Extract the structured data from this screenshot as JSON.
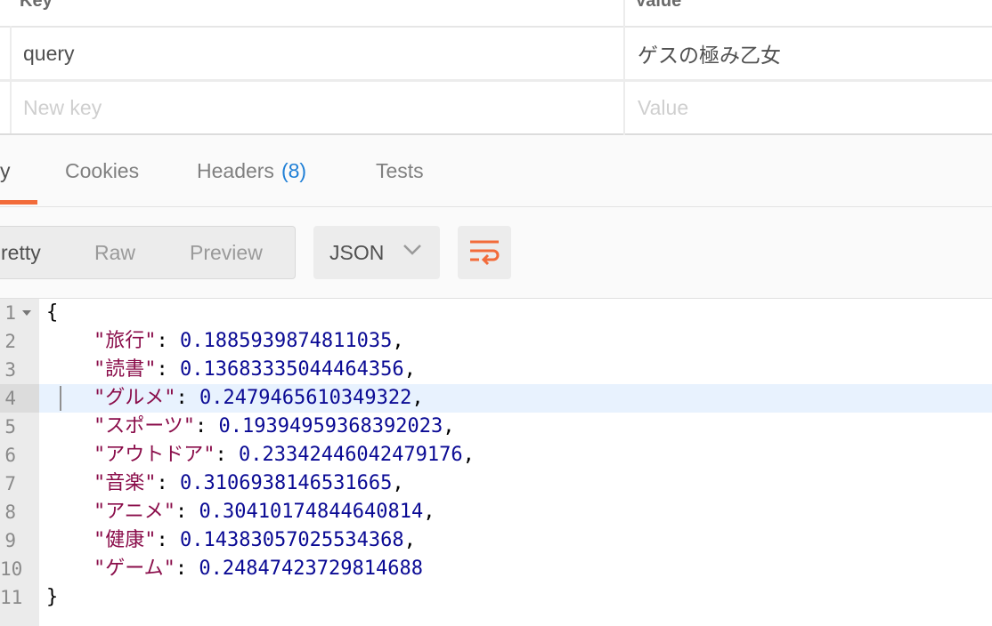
{
  "params": {
    "header_key": "Key",
    "header_value": "Value",
    "rows": [
      {
        "key": "query",
        "value": "ゲスの極み乙女"
      }
    ],
    "new_key_placeholder": "New key",
    "new_value_placeholder": "Value"
  },
  "tabs": {
    "body_fragment": "y",
    "cookies": "Cookies",
    "headers": "Headers",
    "headers_count": "(8)",
    "tests": "Tests"
  },
  "toolbar": {
    "pretty": "retty",
    "raw": "Raw",
    "preview": "Preview",
    "format": "JSON",
    "wrap_icon": "wrap-lines-icon",
    "accent_color": "#f26b3a"
  },
  "response": {
    "line_numbers": [
      "1",
      "2",
      "3",
      "4",
      "5",
      "6",
      "7",
      "8",
      "9",
      "10",
      "11"
    ],
    "open_brace": "{",
    "close_brace": "}",
    "entries": [
      {
        "key": "\"旅行\"",
        "value": "0.1885939874811035",
        "sep": ","
      },
      {
        "key": "\"読書\"",
        "value": "0.13683335044464356",
        "sep": ","
      },
      {
        "key": "\"グルメ\"",
        "value": "0.2479465610349322",
        "sep": ","
      },
      {
        "key": "\"スポーツ\"",
        "value": "0.19394959368392023",
        "sep": ","
      },
      {
        "key": "\"アウトドア\"",
        "value": "0.23342446042479176",
        "sep": ","
      },
      {
        "key": "\"音楽\"",
        "value": "0.3106938146531665",
        "sep": ","
      },
      {
        "key": "\"アニメ\"",
        "value": "0.30410174844640814",
        "sep": ","
      },
      {
        "key": "\"健康\"",
        "value": "0.14383057025534368",
        "sep": ","
      },
      {
        "key": "\"ゲーム\"",
        "value": "0.24847423729814688",
        "sep": ""
      }
    ]
  }
}
